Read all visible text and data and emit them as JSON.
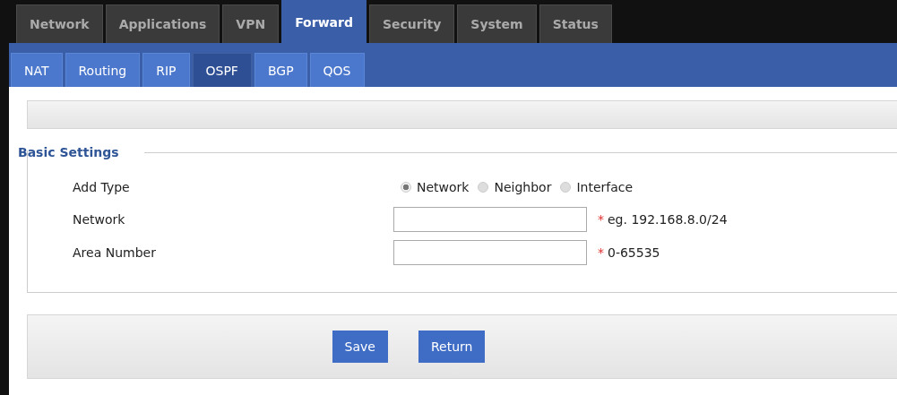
{
  "main_tabs": [
    {
      "label": "Network",
      "selected": false
    },
    {
      "label": "Applications",
      "selected": false
    },
    {
      "label": "VPN",
      "selected": false
    },
    {
      "label": "Forward",
      "selected": true
    },
    {
      "label": "Security",
      "selected": false
    },
    {
      "label": "System",
      "selected": false
    },
    {
      "label": "Status",
      "selected": false
    }
  ],
  "sub_tabs": [
    {
      "label": "NAT",
      "selected": false
    },
    {
      "label": "Routing",
      "selected": false
    },
    {
      "label": "RIP",
      "selected": false
    },
    {
      "label": "OSPF",
      "selected": true
    },
    {
      "label": "BGP",
      "selected": false
    },
    {
      "label": "QOS",
      "selected": false
    }
  ],
  "section": {
    "title": "Basic Settings",
    "rows": [
      {
        "kind": "radio",
        "label": "Add Type",
        "options": [
          {
            "label": "Network",
            "selected": true
          },
          {
            "label": "Neighbor",
            "selected": false
          },
          {
            "label": "Interface",
            "selected": false
          }
        ]
      },
      {
        "kind": "text",
        "label": "Network",
        "required_mark": "*",
        "hint": "eg. 192.168.8.0/24"
      },
      {
        "kind": "text",
        "label": "Area Number",
        "required_mark": "*",
        "hint": "0-65535"
      }
    ]
  },
  "buttons": [
    "Save",
    "Return"
  ]
}
